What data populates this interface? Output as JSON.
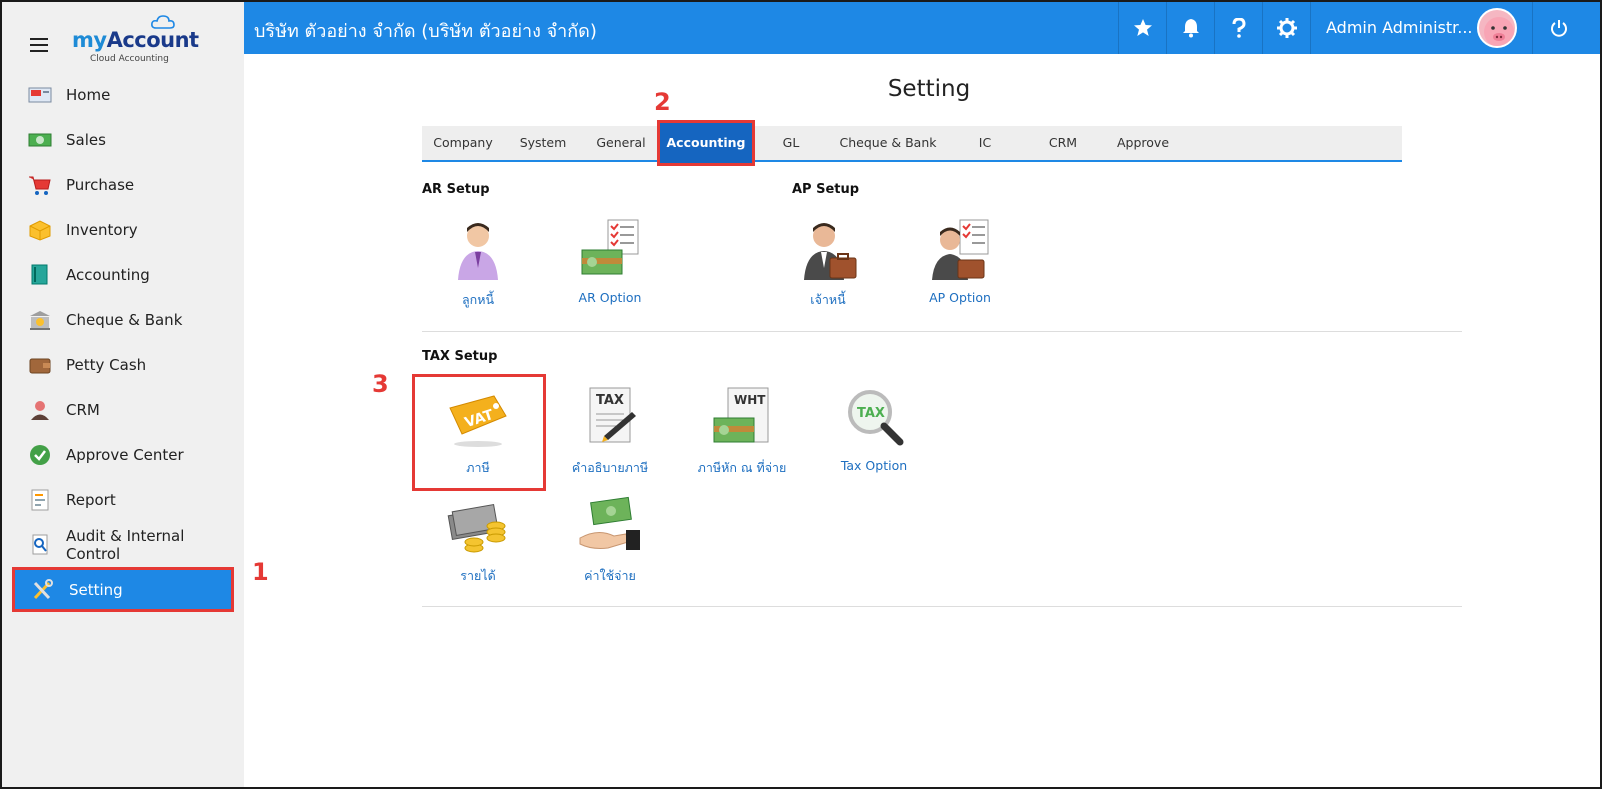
{
  "sidebar": {
    "brand_my": "my",
    "brand_account": "Account",
    "brand_sub": "Cloud Accounting",
    "items": [
      {
        "label": "Home",
        "icon": "home-icon"
      },
      {
        "label": "Sales",
        "icon": "money-icon"
      },
      {
        "label": "Purchase",
        "icon": "cart-icon"
      },
      {
        "label": "Inventory",
        "icon": "box-icon"
      },
      {
        "label": "Accounting",
        "icon": "book-icon"
      },
      {
        "label": "Cheque & Bank",
        "icon": "bank-icon"
      },
      {
        "label": "Petty Cash",
        "icon": "wallet-icon"
      },
      {
        "label": "CRM",
        "icon": "people-icon"
      },
      {
        "label": "Approve Center",
        "icon": "check-icon"
      },
      {
        "label": "Report",
        "icon": "report-icon"
      },
      {
        "label": "Audit & Internal Control",
        "icon": "audit-icon"
      },
      {
        "label": "Setting",
        "icon": "tools-icon",
        "active": true
      }
    ]
  },
  "header": {
    "company": "บริษัท ตัวอย่าง จำกัด (บริษัท ตัวอย่าง จำกัด)",
    "user": "Admin Administr...",
    "colors": {
      "bar": "#1e88e5"
    }
  },
  "main": {
    "title": "Setting",
    "tabs": [
      "Company",
      "System",
      "General",
      "Accounting",
      "GL",
      "Cheque & Bank",
      "IC",
      "CRM",
      "Approve"
    ],
    "active_tab": "Accounting",
    "ar_setup": {
      "title": "AR Setup",
      "items": [
        "ลูกหนี้",
        "AR Option"
      ]
    },
    "ap_setup": {
      "title": "AP Setup",
      "items": [
        "เจ้าหนี้",
        "AP Option"
      ]
    },
    "tax_setup": {
      "title": "TAX Setup",
      "items": [
        "ภาษี",
        "คำอธิบายภาษี",
        "ภาษีหัก ณ ที่จ่าย",
        "Tax Option",
        "รายได้",
        "ค่าใช้จ่าย"
      ],
      "icon_text": {
        "vat": "VAT",
        "tax": "TAX",
        "wht": "WHT",
        "tax_option": "TAX"
      }
    }
  },
  "annotations": {
    "step1": "1",
    "step2": "2",
    "step3": "3",
    "color": "#e53935"
  }
}
